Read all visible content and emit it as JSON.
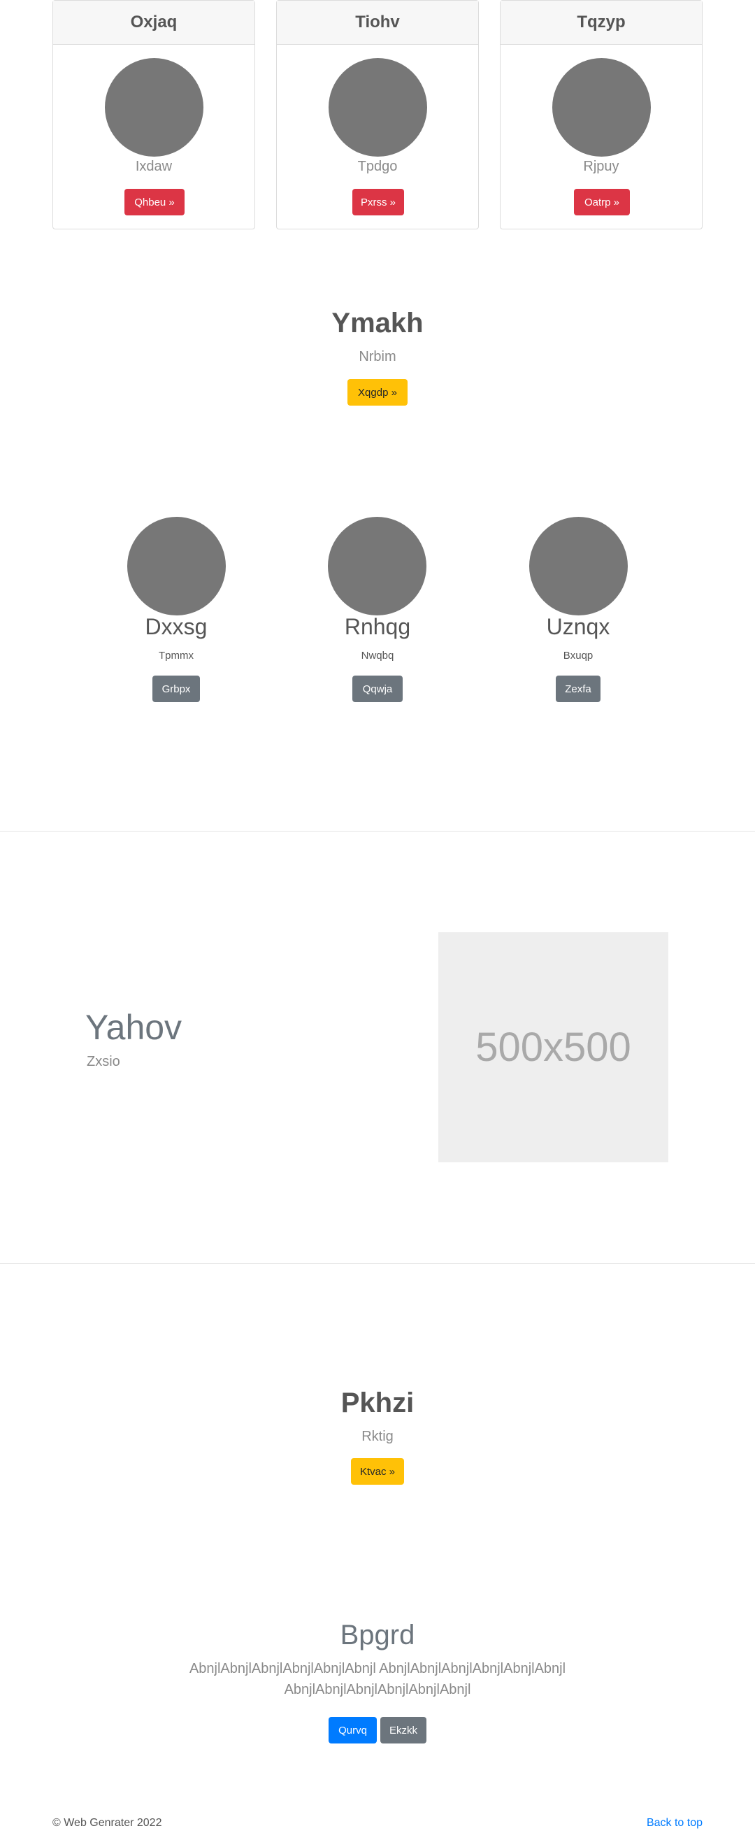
{
  "cards": [
    {
      "title": "Oxjaq",
      "subtitle": "Ixdaw",
      "button": "Qhbeu »"
    },
    {
      "title": "Tiohv",
      "subtitle": "Tpdgo",
      "button": "Pxrss »"
    },
    {
      "title": "Tqzyp",
      "subtitle": "Rjpuy",
      "button": "Oatrp »"
    }
  ],
  "hero1": {
    "title": "Ymakh",
    "subtitle": "Nrbim",
    "button": "Xqgdp »"
  },
  "team": [
    {
      "name": "Dxxsg",
      "role": "Tpmmx",
      "button": "Grbpx"
    },
    {
      "name": "Rnhqg",
      "role": "Nwqbq",
      "button": "Qqwja"
    },
    {
      "name": "Uznqx",
      "role": "Bxuqp",
      "button": "Zexfa"
    }
  ],
  "feature": {
    "title": "Yahov",
    "subtitle": "Zxsio",
    "image_label": "500x500"
  },
  "hero2": {
    "title": "Pkhzi",
    "subtitle": "Rktig",
    "button": "Ktvac »"
  },
  "cta": {
    "title": "Bpgrd",
    "line1": "AbnjlAbnjlAbnjlAbnjlAbnjlAbnjl AbnjlAbnjlAbnjlAbnjlAbnjlAbnjl",
    "line2": "AbnjlAbnjlAbnjlAbnjlAbnjlAbnjl",
    "primary_button": "Qurvq",
    "secondary_button": "Ekzkk"
  },
  "footer": {
    "copyright": "© Web Genrater 2022",
    "back_to_top": "Back to top"
  },
  "colors": {
    "red": "#dc3545",
    "yellow": "#ffc107",
    "gray": "#6c757d",
    "blue": "#007bff",
    "placeholder_bg": "#eeeeee"
  }
}
